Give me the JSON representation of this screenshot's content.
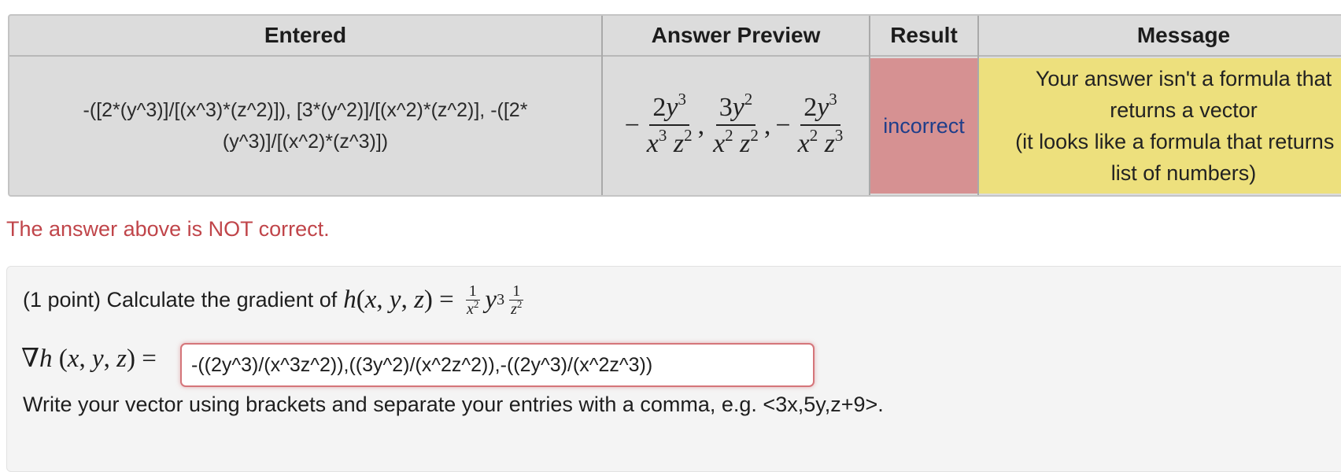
{
  "table": {
    "headers": {
      "entered": "Entered",
      "preview": "Answer Preview",
      "result": "Result",
      "message": "Message"
    },
    "row": {
      "entered_line1": "-([2*(y^3)]/[(x^3)*(z^2)]), [3*(y^2)]/[(x^2)*(z^2)], -([2*",
      "entered_line2": "(y^3)]/[(x^2)*(z^3)])",
      "result": "incorrect",
      "message_lines": [
        "Your answer isn't a formula that",
        "returns a vector",
        "(it looks like a formula that returns a",
        "list of numbers)"
      ]
    },
    "colors": {
      "header_bg": "#dcdcdc",
      "result_bg": "#d69192",
      "message_bg": "#ede07d",
      "result_text": "#1f3e8a"
    }
  },
  "feedback": {
    "text": "The answer above is NOT correct.",
    "color": "#c0454a"
  },
  "problem": {
    "prompt": "(1 point) Calculate the gradient of",
    "answer_value": "-((2y^3)/(x^3z^2)),((3y^2)/(x^2z^2)),-((2y^3)/(x^2z^3))",
    "hint": "Write your vector using brackets and separate your entries with a comma, e.g. <3x,5y,z+9>."
  }
}
